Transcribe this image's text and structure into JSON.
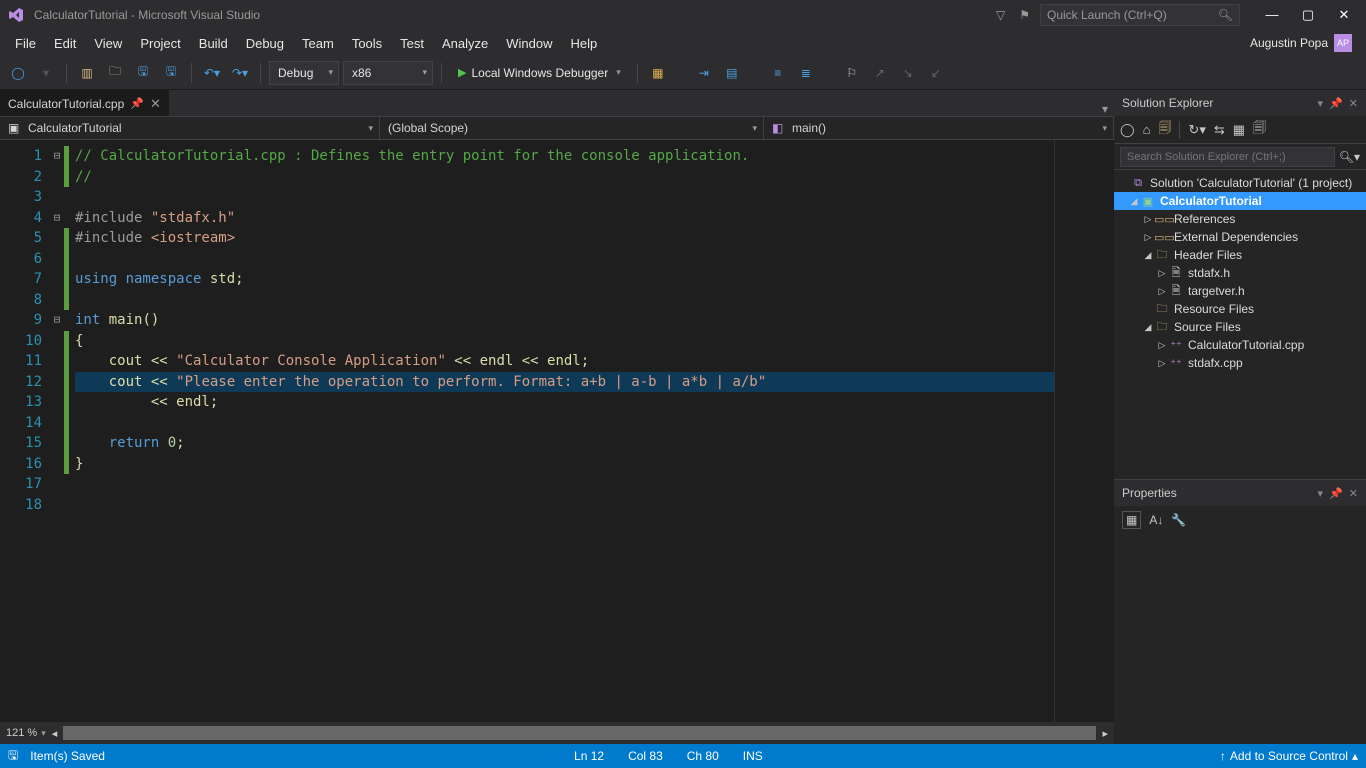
{
  "title": "CalculatorTutorial - Microsoft Visual Studio",
  "quicklaunch_placeholder": "Quick Launch (Ctrl+Q)",
  "menus": [
    "File",
    "Edit",
    "View",
    "Project",
    "Build",
    "Debug",
    "Team",
    "Tools",
    "Test",
    "Analyze",
    "Window",
    "Help"
  ],
  "user": {
    "name": "Augustin Popa",
    "initials": "AP"
  },
  "toolbar": {
    "config": "Debug",
    "platform": "x86",
    "debugger": "Local Windows Debugger"
  },
  "tab": {
    "name": "CalculatorTutorial.cpp"
  },
  "nav": {
    "left": "CalculatorTutorial",
    "mid": "(Global Scope)",
    "right": "main()"
  },
  "solution_explorer": {
    "title": "Solution Explorer",
    "search_placeholder": "Search Solution Explorer (Ctrl+;)",
    "solution": "Solution 'CalculatorTutorial' (1 project)",
    "project": "CalculatorTutorial",
    "nodes": {
      "references": "References",
      "external": "External Dependencies",
      "headers": "Header Files",
      "h1": "stdafx.h",
      "h2": "targetver.h",
      "resources": "Resource Files",
      "sources": "Source Files",
      "s1": "CalculatorTutorial.cpp",
      "s2": "stdafx.cpp"
    }
  },
  "properties": {
    "title": "Properties"
  },
  "status": {
    "left": "Item(s) Saved",
    "ln": "Ln 12",
    "col": "Col 83",
    "ch": "Ch 80",
    "ins": "INS",
    "src": "Add to Source Control"
  },
  "zoom": "121 %",
  "code": {
    "lines": [
      {
        "n": 1,
        "fold": "⊟",
        "mk": "g",
        "html": "<span class='c-comment'>// CalculatorTutorial.cpp : Defines the entry point for the console application.</span>"
      },
      {
        "n": 2,
        "fold": "",
        "mk": "g",
        "html": "<span class='c-comment'>//</span>"
      },
      {
        "n": 3,
        "fold": "",
        "mk": "",
        "html": ""
      },
      {
        "n": 4,
        "fold": "⊟",
        "mk": "",
        "html": "<span class='c-pp'>#include </span><span class='c-str'>\"stdafx.h\"</span>"
      },
      {
        "n": 5,
        "fold": "",
        "mk": "g",
        "html": "<span class='c-pp'>#include </span><span class='c-str'>&lt;iostream&gt;</span>"
      },
      {
        "n": 6,
        "fold": "",
        "mk": "g",
        "html": ""
      },
      {
        "n": 7,
        "fold": "",
        "mk": "g",
        "html": "<span class='c-inc'>using namespace</span><span class='c-txt'> std;</span>"
      },
      {
        "n": 8,
        "fold": "",
        "mk": "g",
        "html": ""
      },
      {
        "n": 9,
        "fold": "⊟",
        "mk": "",
        "html": "<span class='c-inc'>int</span><span class='c-txt'> </span><span class='c-fn'>main</span><span class='c-txt'>()</span>"
      },
      {
        "n": 10,
        "fold": "",
        "mk": "g",
        "html": "<span class='c-txt'>{</span>"
      },
      {
        "n": 11,
        "fold": "",
        "mk": "g",
        "html": "    <span class='c-txt'>cout &lt;&lt; </span><span class='c-str'>\"Calculator Console Application\"</span><span class='c-txt'> &lt;&lt; endl &lt;&lt; endl;</span>"
      },
      {
        "n": 12,
        "fold": "",
        "mk": "g",
        "hl": true,
        "html": "    <span class='c-txt'>cout &lt;&lt; </span><span class='c-str'>\"Please enter the operation to perform. Format: a+b | a-b | a*b | a/b\"</span>"
      },
      {
        "n": 13,
        "fold": "",
        "mk": "g",
        "html": "         <span class='c-txt'>&lt;&lt; endl;</span>"
      },
      {
        "n": 14,
        "fold": "",
        "mk": "g",
        "html": ""
      },
      {
        "n": 15,
        "fold": "",
        "mk": "g",
        "html": "    <span class='c-inc'>return</span><span class='c-txt'> </span><span class='c-num'>0</span><span class='c-txt'>;</span>"
      },
      {
        "n": 16,
        "fold": "",
        "mk": "g",
        "html": "<span class='c-txt'>}</span>"
      },
      {
        "n": 17,
        "fold": "",
        "mk": "",
        "html": ""
      },
      {
        "n": 18,
        "fold": "",
        "mk": "",
        "html": ""
      }
    ]
  }
}
